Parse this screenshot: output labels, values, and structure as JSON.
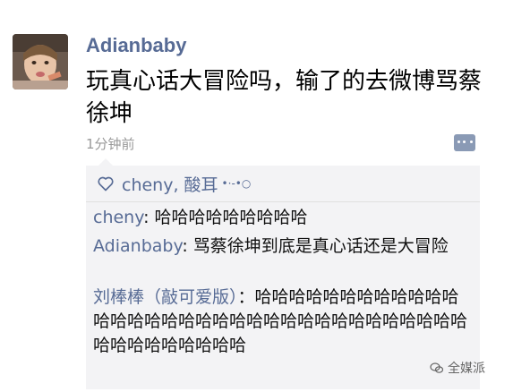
{
  "post": {
    "username": "Adianbaby",
    "text": "玩真心话大冒险吗，输了的去微博骂蔡徐坤",
    "timestamp": "1分钟前"
  },
  "likes": {
    "names": "cheny, 酸耳",
    "emoji": "•·-•○"
  },
  "comments": [
    {
      "author": "cheny",
      "separator": ": ",
      "text": "哈哈哈哈哈哈哈哈哈"
    },
    {
      "author": "Adianbaby",
      "separator": ": ",
      "text": "骂蔡徐坤到底是真心话还是大冒险"
    },
    {
      "author": "刘棒棒（敲可爱版）",
      "separator": "：",
      "text": "哈哈哈哈哈哈哈哈哈哈哈哈哈哈哈哈哈哈哈哈哈哈哈哈哈哈哈哈哈哈哈哈哈哈哈哈哈哈哈哈哈哈哈"
    }
  ],
  "watermark": {
    "text": "全媒派",
    "icon": "wechat-logo-icon"
  },
  "icons": {
    "avatar": "avatar-photo",
    "like": "heart-icon",
    "comment": "comment-icon"
  },
  "colors": {
    "link": "#576b95",
    "timestamp": "#999999",
    "comment_bg": "#f3f3f5"
  }
}
